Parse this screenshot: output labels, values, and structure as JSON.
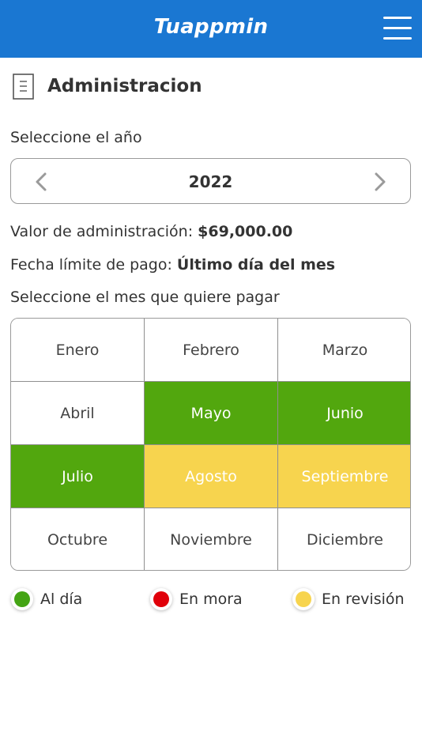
{
  "header": {
    "app_title": "Tuappmin",
    "menu_icon": "hamburger-menu-icon"
  },
  "page": {
    "title": "Administracion",
    "title_icon": "document-icon"
  },
  "year_selector": {
    "prompt": "Seleccione el año",
    "value": "2022",
    "prev_icon": "chevron-left-icon",
    "next_icon": "chevron-right-icon"
  },
  "info": {
    "admin_value_label": "Valor de administración:",
    "admin_value": "$69,000.00",
    "deadline_label": "Fecha límite de pago:",
    "deadline_value": "Último día del mes",
    "month_prompt": "Seleccione el mes que quiere pagar"
  },
  "months": [
    {
      "label": "Enero",
      "status": "none"
    },
    {
      "label": "Febrero",
      "status": "none"
    },
    {
      "label": "Marzo",
      "status": "none"
    },
    {
      "label": "Abril",
      "status": "none"
    },
    {
      "label": "Mayo",
      "status": "paid"
    },
    {
      "label": "Junio",
      "status": "paid"
    },
    {
      "label": "Julio",
      "status": "paid"
    },
    {
      "label": "Agosto",
      "status": "review"
    },
    {
      "label": "Septiembre",
      "status": "review"
    },
    {
      "label": "Octubre",
      "status": "none"
    },
    {
      "label": "Noviembre",
      "status": "none"
    },
    {
      "label": "Diciembre",
      "status": "none"
    }
  ],
  "legend": [
    {
      "label": "Al día",
      "color": "#44a414"
    },
    {
      "label": "En mora",
      "color": "#e0000a"
    },
    {
      "label": "En revisión",
      "color": "#f7d44e"
    }
  ],
  "colors": {
    "header": "#1a77d2",
    "paid": "#52a70e",
    "review": "#f7d44e"
  }
}
